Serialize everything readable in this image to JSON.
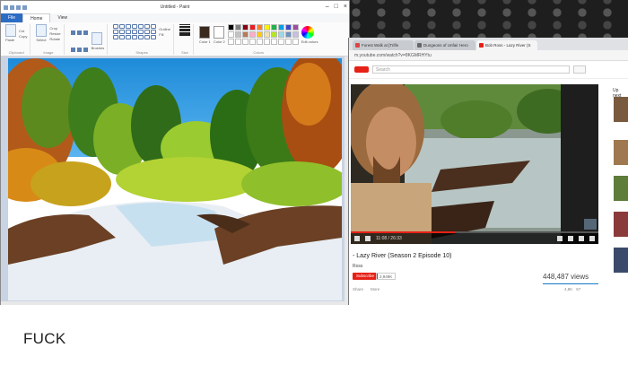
{
  "paint": {
    "title": "Untitled - Paint",
    "tabs": [
      "File",
      "Home",
      "View"
    ],
    "groups": {
      "clipboard": {
        "paste": "Paste",
        "cut": "Cut",
        "copy": "Copy",
        "caption": "Clipboard"
      },
      "image": {
        "select": "Select",
        "crop": "Crop",
        "resize": "Resize",
        "rotate": "Rotate",
        "caption": "Image"
      },
      "tools": {
        "caption": "Tools"
      },
      "brushes": {
        "label": "Brushes"
      },
      "shapes": {
        "outline": "Outline",
        "fill": "Fill",
        "caption": "Shapes"
      },
      "size": {
        "label": "Size"
      },
      "colors": {
        "color1": "Color 1",
        "color2": "Color 2",
        "edit": "Edit colors",
        "caption": "Colors"
      }
    },
    "palette": [
      "#000000",
      "#7f7f7f",
      "#880015",
      "#ed1c24",
      "#ff7f27",
      "#fff200",
      "#22b14c",
      "#00a2e8",
      "#3f48cc",
      "#a349a4",
      "#ffffff",
      "#c3c3c3",
      "#b97a57",
      "#ffaec9",
      "#ffc90e",
      "#efe4b0",
      "#b5e61d",
      "#99d9ea",
      "#7092be",
      "#c8bfe7",
      "#ffffff",
      "#ffffff",
      "#ffffff",
      "#ffffff",
      "#ffffff",
      "#ffffff",
      "#ffffff",
      "#ffffff",
      "#ffffff",
      "#ffffff"
    ],
    "color1": "#3b2a1e",
    "color2": "#ffffff"
  },
  "chrome": {
    "tabs": [
      {
        "label": "Forest Walk at [Trifle",
        "color": "#d44"
      },
      {
        "label": "Dungeons of Unfair Hero",
        "color": "#666"
      },
      {
        "label": "Bob Ross - Lazy River (S",
        "color": "#e62117"
      }
    ],
    "url": "m.youtube.com/watch?v=8KGMRHYtu",
    "search_placeholder": "Search",
    "video": {
      "time": "11:08 / 26:33",
      "progress": 0.42,
      "title": "- Lazy River (Season 2 Episode 10)",
      "channel": "Ross",
      "subscribe": "Subscribe",
      "subscribers": "2,949K",
      "views": "448,487 views",
      "add_to": "Share",
      "more": "More",
      "likes": "4,8K",
      "dislikes": "67"
    },
    "up_next": "Up next"
  },
  "caption": "FUCK"
}
